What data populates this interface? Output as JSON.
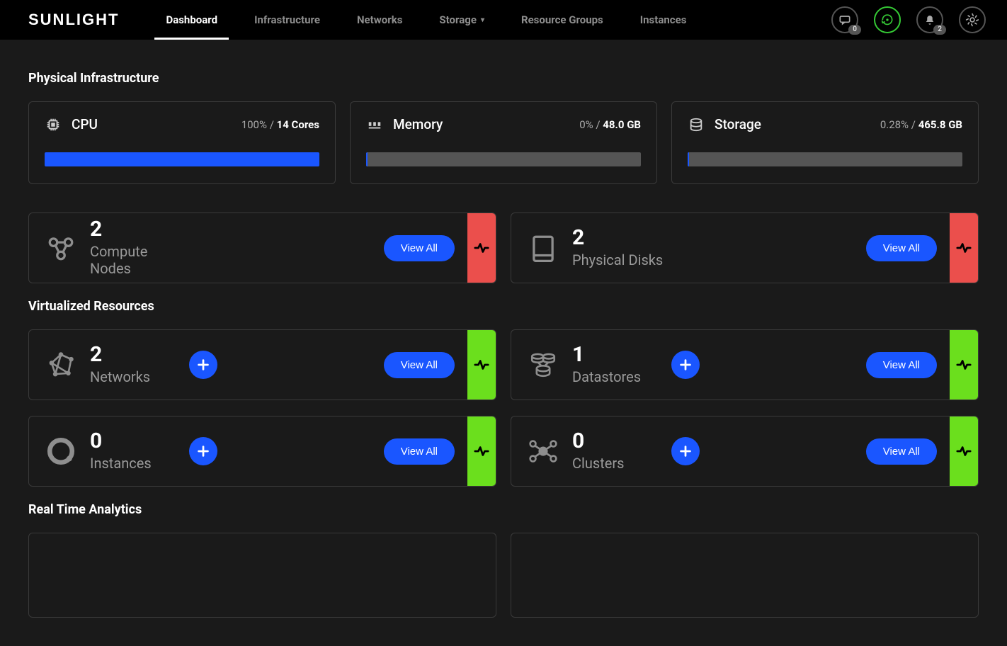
{
  "brand": "SUNLIGHT",
  "nav": {
    "items": [
      {
        "label": "Dashboard",
        "active": true
      },
      {
        "label": "Infrastructure"
      },
      {
        "label": "Networks"
      },
      {
        "label": "Storage",
        "dropdown": true
      },
      {
        "label": "Resource Groups"
      },
      {
        "label": "Instances"
      }
    ]
  },
  "header": {
    "messages_badge": "0",
    "notifications_badge": "2"
  },
  "sections": {
    "physical": "Physical Infrastructure",
    "virtual": "Virtualized Resources",
    "analytics": "Real Time Analytics"
  },
  "resources": {
    "cpu": {
      "name": "CPU",
      "pct": "100%",
      "total": "14 Cores",
      "fill": 100
    },
    "memory": {
      "name": "Memory",
      "pct": "0%",
      "total": "48.0 GB",
      "fill": 0
    },
    "storage": {
      "name": "Storage",
      "pct": "0.28%",
      "total": "465.8 GB",
      "fill": 0.28
    }
  },
  "buttons": {
    "view_all": "View All"
  },
  "cards": {
    "compute": {
      "count": "2",
      "label": "Compute Nodes",
      "status": "red",
      "add": false,
      "icon": "compute"
    },
    "disks": {
      "count": "2",
      "label": "Physical Disks",
      "status": "red",
      "add": false,
      "icon": "disk"
    },
    "networks": {
      "count": "2",
      "label": "Networks",
      "status": "green",
      "add": true,
      "icon": "network"
    },
    "datastores": {
      "count": "1",
      "label": "Datastores",
      "status": "green",
      "add": true,
      "icon": "datastore"
    },
    "instances": {
      "count": "0",
      "label": "Instances",
      "status": "green",
      "add": true,
      "icon": "instance"
    },
    "clusters": {
      "count": "0",
      "label": "Clusters",
      "status": "green",
      "add": true,
      "icon": "cluster"
    }
  }
}
